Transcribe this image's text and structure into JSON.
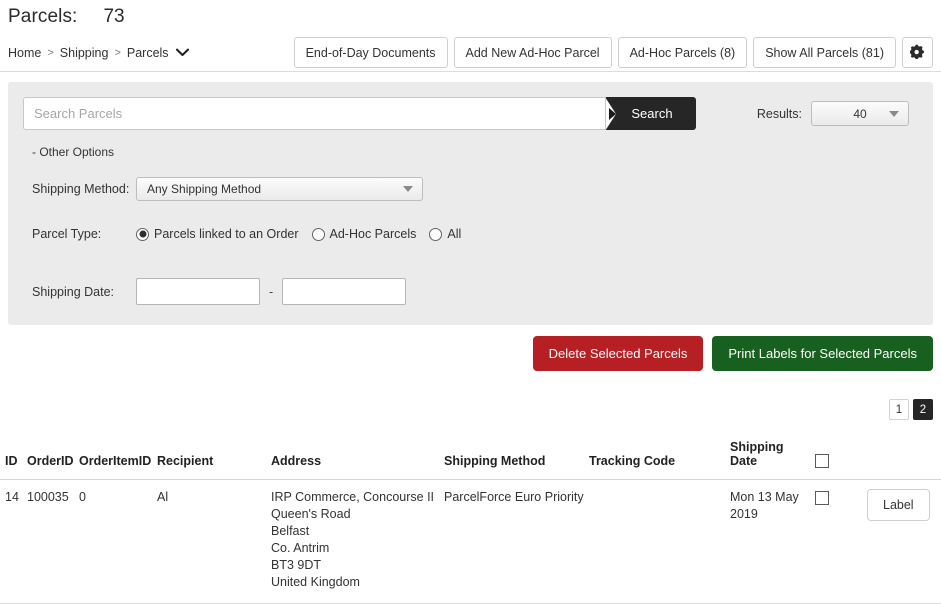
{
  "header": {
    "title": "Parcels:",
    "count": "73"
  },
  "breadcrumb": {
    "items": [
      "Home",
      "Shipping",
      "Parcels"
    ],
    "separator": ">",
    "caret_icon": "chevron-down-icon"
  },
  "head_actions": {
    "end_of_day": "End-of-Day Documents",
    "add_adhoc": "Add New Ad-Hoc Parcel",
    "adhoc_parcels": "Ad-Hoc Parcels (8)",
    "show_all": "Show All Parcels (81)",
    "settings_icon": "gear-icon"
  },
  "search": {
    "placeholder": "Search Parcels",
    "value": "",
    "button_label": "Search",
    "results_label": "Results:",
    "results_value": "40",
    "other_options_label": "- Other Options"
  },
  "filters": {
    "shipping_method_label": "Shipping Method:",
    "shipping_method_value": "Any Shipping Method",
    "parcel_type_label": "Parcel Type:",
    "parcel_type_options": [
      {
        "label": "Parcels linked to an Order",
        "selected": true
      },
      {
        "label": "Ad-Hoc Parcels",
        "selected": false
      },
      {
        "label": "All",
        "selected": false
      }
    ],
    "shipping_date_label": "Shipping Date:",
    "date_from": "",
    "date_to": "",
    "date_separator": "-"
  },
  "actions": {
    "delete_label": "Delete Selected Parcels",
    "print_label": "Print Labels for Selected Parcels"
  },
  "pagination": {
    "pages": [
      "1",
      "2"
    ],
    "active": "2"
  },
  "table": {
    "columns": [
      "ID",
      "OrderID",
      "OrderItemID",
      "Recipient",
      "Address",
      "Shipping Method",
      "Tracking Code",
      "Shipping Date"
    ],
    "rows": [
      {
        "id": "14",
        "order_id": "100035",
        "order_item_id": "0",
        "recipient": "Al",
        "address": [
          "IRP Commerce, Concourse II",
          "Queen's Road",
          "Belfast",
          "Co. Antrim",
          "BT3 9DT",
          "United Kingdom"
        ],
        "shipping_method": "ParcelForce Euro Priority",
        "tracking_code": "",
        "shipping_date": "Mon 13 May 2019",
        "label_button": "Label"
      }
    ]
  },
  "colors": {
    "panel_bg": "#ebebeb",
    "danger": "#b62025",
    "success": "#18601f",
    "dark": "#262626"
  }
}
